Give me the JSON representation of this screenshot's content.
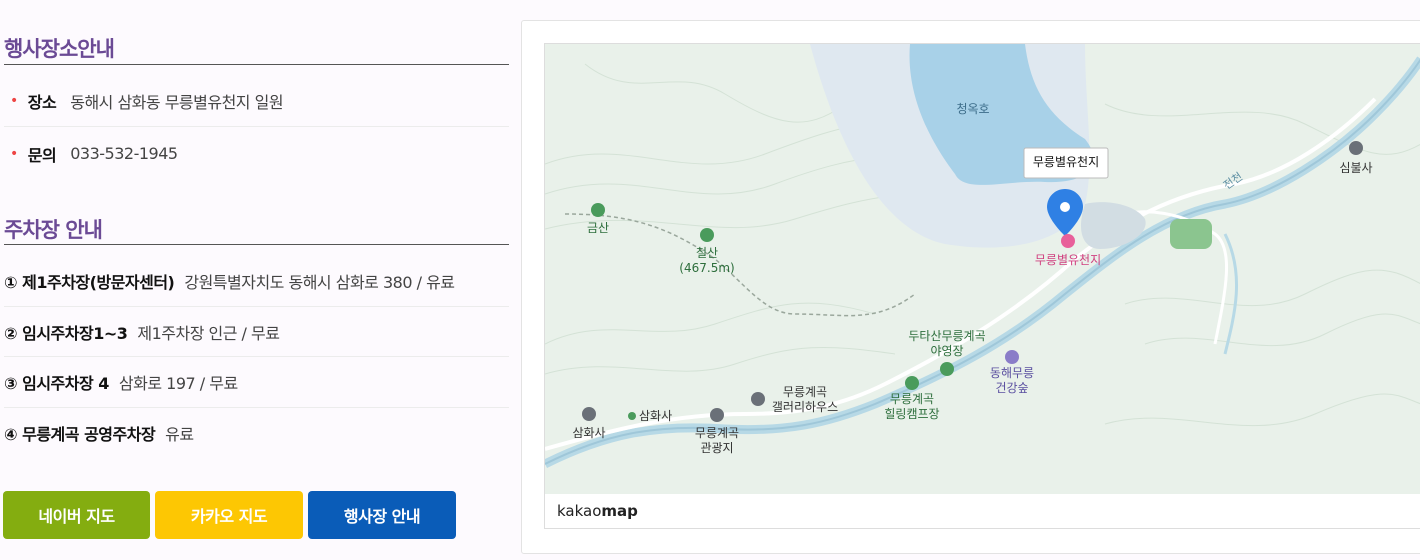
{
  "venue": {
    "title": "행사장소안내",
    "items": [
      {
        "label": "장소",
        "value": "동해시 삼화동 무릉별유천지 일원"
      },
      {
        "label": "문의",
        "value": "033-532-1945"
      }
    ]
  },
  "parking": {
    "title": "주차장 안내",
    "items": [
      {
        "label": "① 제1주차장(방문자센터)",
        "value": "강원특별자치도 동해시 삼화로 380 / 유료"
      },
      {
        "label": "② 임시주차장1~3",
        "value": "제1주차장 인근 / 무료"
      },
      {
        "label": "③ 임시주차장 4",
        "value": "삼화로 197 / 무료"
      },
      {
        "label": "④ 무릉계곡 공영주차장",
        "value": "유료"
      }
    ]
  },
  "buttons": {
    "naver": "네이버 지도",
    "kakao": "카카오 지도",
    "venue": "행사장 안내"
  },
  "colors": {
    "naver": "#84ad10",
    "kakao": "#fdc703",
    "venue": "#0a5cb8",
    "title": "#6b4a95"
  },
  "map": {
    "marker_label": "무릉별유천지",
    "marker_name": "무릉별유천지",
    "lake": "청옥호",
    "places": {
      "geumsan": "금산",
      "cheolsan": "철산",
      "cheolsan_height": "(467.5m)",
      "simbulsa": "심불사",
      "stream": "전천",
      "camp1": "두타산무릉계곡",
      "camp1b": "야영장",
      "forest1": "동해무릉",
      "forest1b": "건강숲",
      "camp2": "무릉계곡",
      "camp2b": "힐링캠프장",
      "gallery1": "무릉계곡",
      "gallery1b": "갤러리하우스",
      "samhwasa": "삼화사",
      "samhwasa_stop": "삼화사",
      "tour1": "무릉계곡",
      "tour1b": "관광지"
    },
    "brand_pre": "kakao",
    "brand_bold": "map"
  }
}
